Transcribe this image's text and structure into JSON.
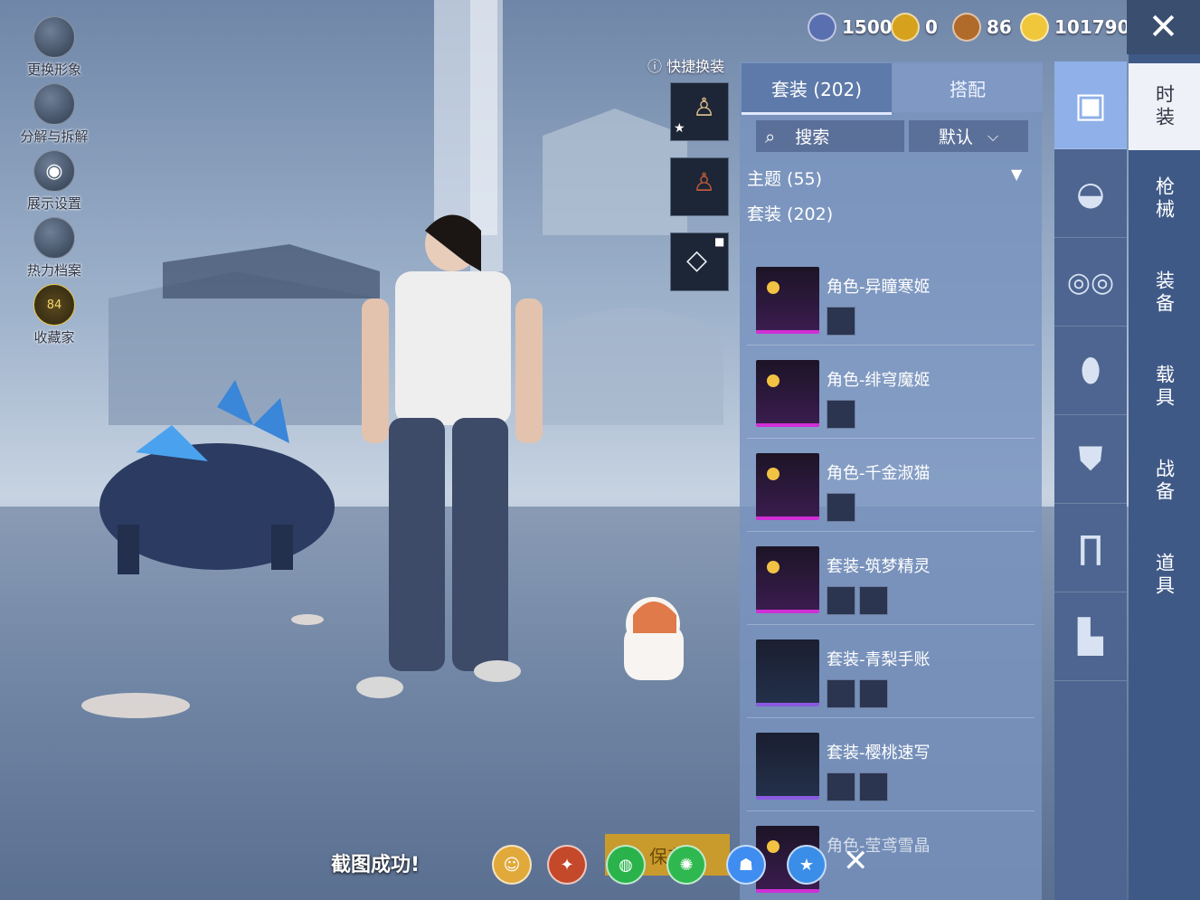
{
  "left_tools": [
    {
      "label": "更换形象",
      "icon": "avatar-icon"
    },
    {
      "label": "分解与拆解",
      "icon": "puzzle-icon"
    },
    {
      "label": "展示设置",
      "icon": "eye-icon"
    },
    {
      "label": "热力档案",
      "icon": "flame-icon"
    },
    {
      "label": "收藏家",
      "icon": "collector-badge-icon",
      "badge": "84"
    }
  ],
  "currencies": [
    {
      "value": "1500",
      "icon": "globe-coin-icon",
      "color": "#5a6fb0"
    },
    {
      "value": "0",
      "icon": "gold-coin-icon",
      "color": "#d6a21d"
    },
    {
      "value": "86",
      "icon": "bronze-coin-icon",
      "color": "#b06a2a"
    },
    {
      "value": "101790",
      "icon": "lightning-coin-icon",
      "color": "#f0c63a"
    }
  ],
  "quick_change_label": "快捷换装",
  "tabs": [
    {
      "label": "套装 (202)",
      "active": true
    },
    {
      "label": "搭配",
      "active": false
    }
  ],
  "search": {
    "label": "搜索",
    "icon": "search-icon"
  },
  "sort": {
    "label": "默认",
    "icon": "chevron-down-icon"
  },
  "filters": {
    "theme": "主题 (55)",
    "suits": "套装 (202)"
  },
  "items": [
    {
      "name": "角色-异瞳寒姬",
      "rarity_color": "#d02fd6"
    },
    {
      "name": "角色-绯穹魔姬",
      "rarity_color": "#d02fd6"
    },
    {
      "name": "角色-千金淑猫",
      "rarity_color": "#d02fd6"
    },
    {
      "name": "套装-筑梦精灵",
      "rarity_color": "#d02fd6"
    },
    {
      "name": "套装-青梨手账",
      "rarity_color": "#8b5ae0"
    },
    {
      "name": "套装-樱桃速写",
      "rarity_color": "#8b5ae0"
    },
    {
      "name": "角色-莹鸢雪晶",
      "rarity_color": "#d02fd6"
    }
  ],
  "rail_icons": [
    "outfit-box-icon",
    "cap-icon",
    "glasses-icon",
    "mask-icon",
    "jacket-icon",
    "pants-icon",
    "boots-icon"
  ],
  "categories": [
    {
      "label": "时装",
      "active": true
    },
    {
      "label": "枪械",
      "active": false
    },
    {
      "label": "装备",
      "active": false
    },
    {
      "label": "载具",
      "active": false
    },
    {
      "label": "战备",
      "active": false
    },
    {
      "label": "道具",
      "active": false
    }
  ],
  "bottom": {
    "toast": "截图成功!",
    "save_label": "保存"
  }
}
